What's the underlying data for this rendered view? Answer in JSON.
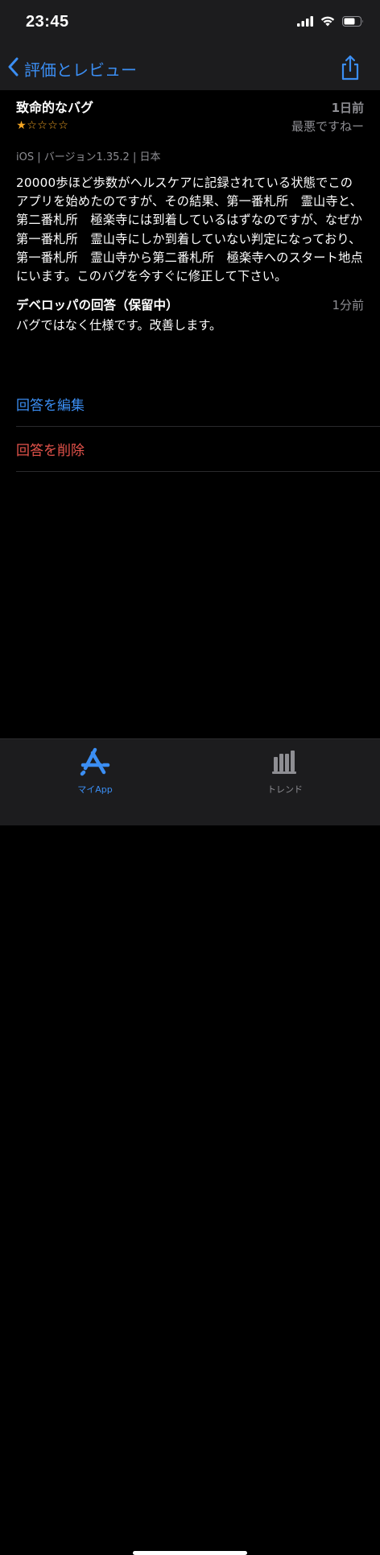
{
  "status_bar": {
    "time": "23:45"
  },
  "nav": {
    "back_label": "評価とレビュー"
  },
  "review": {
    "title": "致命的なバグ",
    "date": "1日前",
    "rating": 1,
    "max_rating": 5,
    "reviewer": "最悪ですねー",
    "meta": "iOS | バージョン1.35.2 | 日本",
    "body": "20000歩ほど歩数がヘルスケアに記録されている状態でこのアプリを始めたのですが、その結果、第一番札所　霊山寺と、第二番札所　極楽寺には到着しているはずなのですが、なぜか第一番札所　霊山寺にしか到着していない判定になっており、第一番札所　霊山寺から第二番札所　極楽寺へのスタート地点にいます。このバグを今すぐに修正して下さい。"
  },
  "developer_response": {
    "title": "デベロッパの回答（保留中）",
    "date": "1分前",
    "text": "バグではなく仕様です。改善します。"
  },
  "actions": {
    "edit_label": "回答を編集",
    "delete_label": "回答を削除"
  },
  "tab_bar": {
    "tabs": [
      {
        "label": "マイApp",
        "icon": "app-store-icon",
        "active": true
      },
      {
        "label": "トレンド",
        "icon": "chart-bars-icon",
        "active": false
      }
    ]
  },
  "colors": {
    "accent": "#3b8ef3",
    "destructive": "#e5534b",
    "star": "#f5a623",
    "secondary_text": "#8e8e93"
  }
}
